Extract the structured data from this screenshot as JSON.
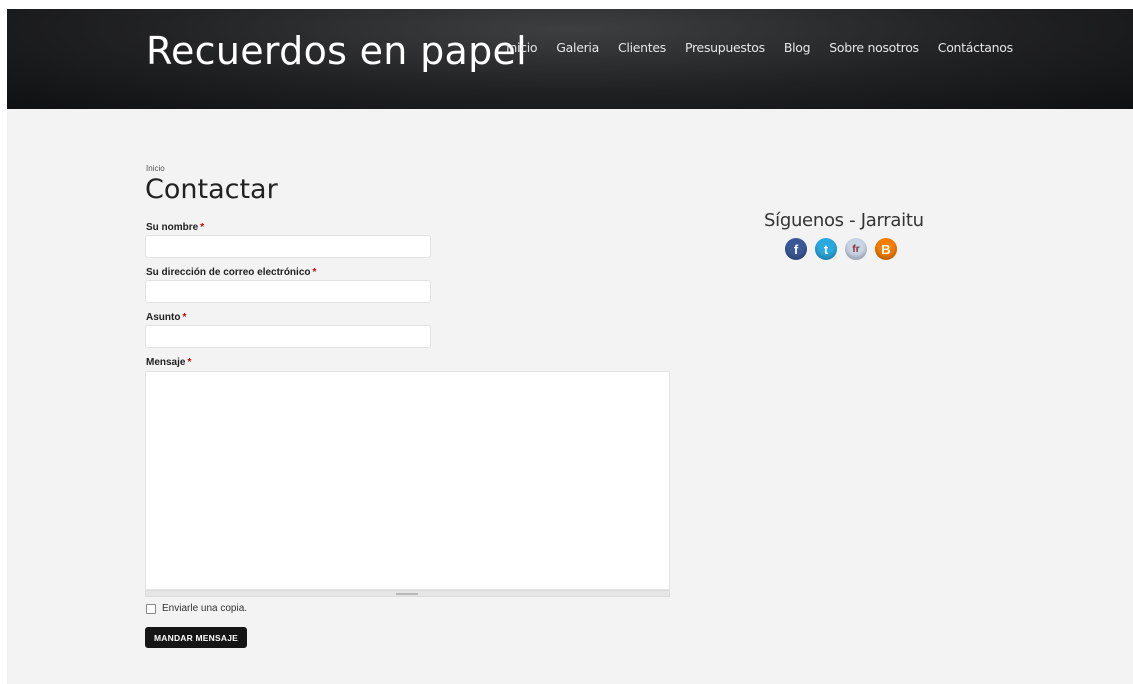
{
  "site": {
    "title": "Recuerdos en papel"
  },
  "nav": [
    {
      "label": "Inicio"
    },
    {
      "label": "Galeria"
    },
    {
      "label": "Clientes"
    },
    {
      "label": "Presupuestos"
    },
    {
      "label": "Blog"
    },
    {
      "label": "Sobre nosotros"
    },
    {
      "label": "Contáctanos"
    }
  ],
  "breadcrumb": "Inicio",
  "page_title": "Contactar",
  "form": {
    "name_label": "Su nombre",
    "email_label": "Su dirección de correo electrónico",
    "subject_label": "Asunto",
    "message_label": "Mensaje",
    "required_mark": "*",
    "name_value": "",
    "email_value": "",
    "subject_value": "",
    "message_value": "",
    "copy_label": "Enviarle una copia.",
    "copy_checked": false,
    "submit_label": "MANDAR MENSAJE"
  },
  "sidebar": {
    "follow_title": "Síguenos - Jarraitu",
    "social": [
      {
        "icon": "facebook-icon",
        "glyph": "f",
        "color": "#3b5998"
      },
      {
        "icon": "twitter-icon",
        "glyph": "t",
        "color": "#2aa9e0"
      },
      {
        "icon": "friendfeed-icon",
        "glyph": "fr",
        "color": "#c9d6e8"
      },
      {
        "icon": "blogger-icon",
        "glyph": "B",
        "color": "#f57d00"
      }
    ]
  }
}
